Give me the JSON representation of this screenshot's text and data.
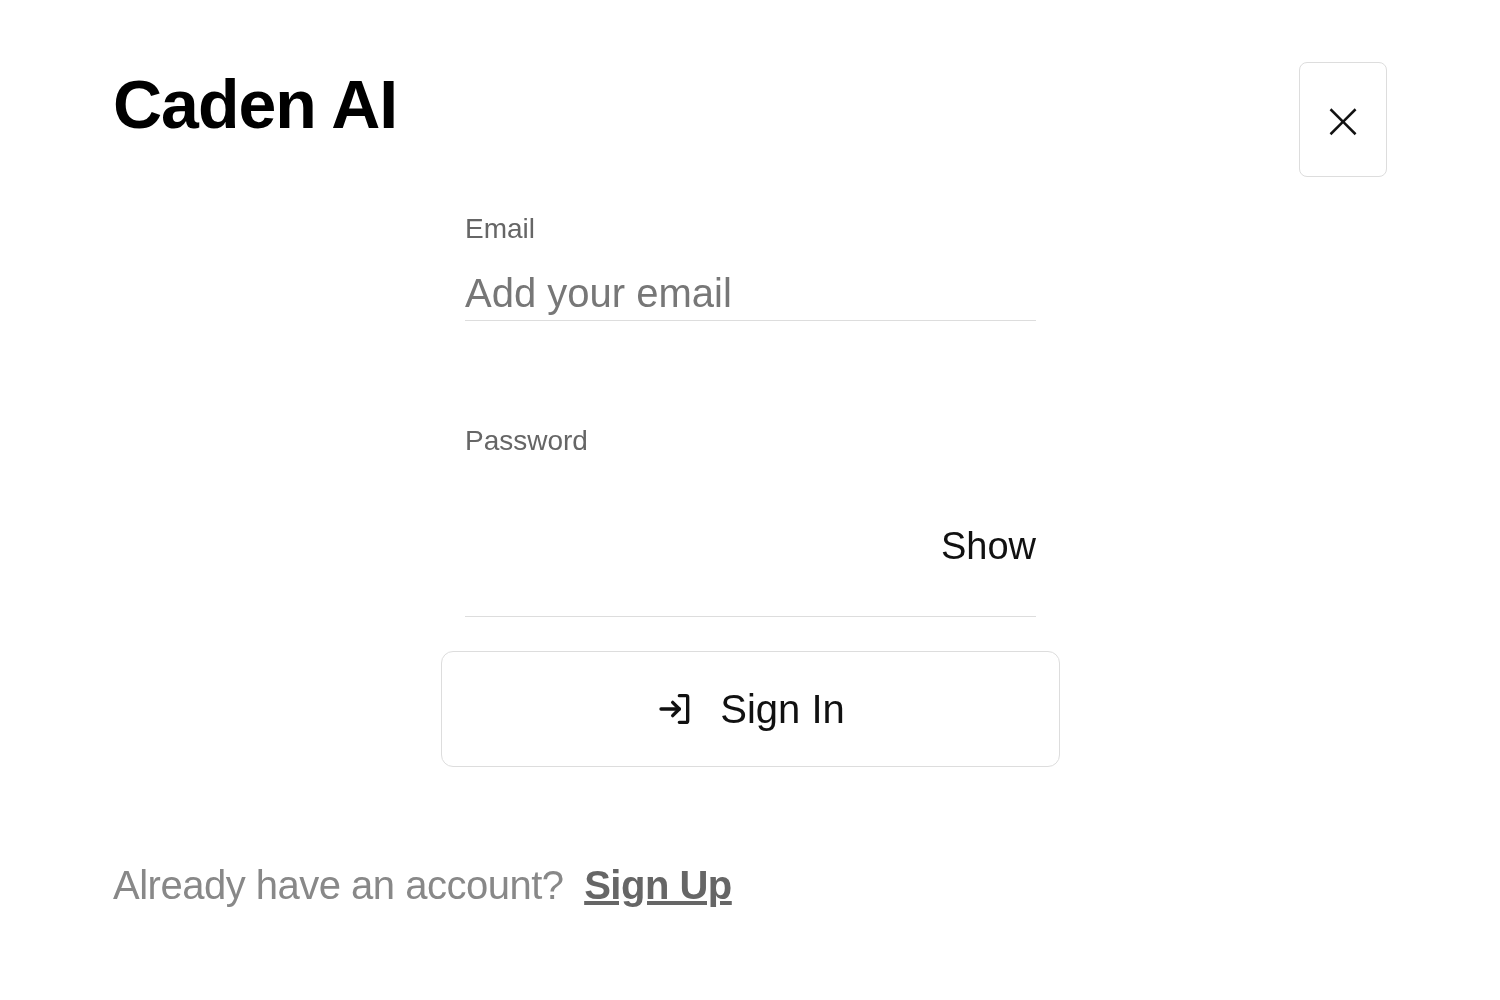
{
  "title": "Caden AI",
  "close_button": {
    "label": "×"
  },
  "email": {
    "label": "Email",
    "placeholder": "Add your email"
  },
  "password": {
    "label": "Password",
    "toggle": "Show"
  },
  "sign_in_button": {
    "label": "Sign In"
  },
  "footer": {
    "text": "Already have an account?",
    "link": "Sign Up"
  }
}
